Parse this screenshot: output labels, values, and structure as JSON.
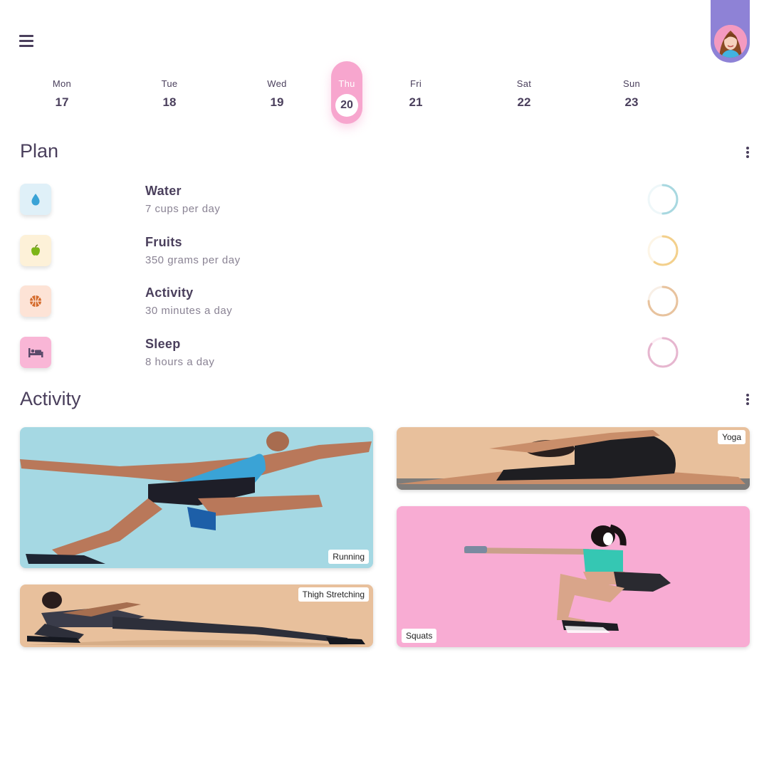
{
  "header": {
    "menu_icon": "hamburger-menu-icon",
    "avatar_icon": "user-avatar"
  },
  "week": {
    "days": [
      {
        "name": "Mon",
        "num": "17"
      },
      {
        "name": "Tue",
        "num": "18"
      },
      {
        "name": "Wed",
        "num": "19"
      },
      {
        "name": "Thu",
        "num": "20"
      },
      {
        "name": "Fri",
        "num": "21"
      },
      {
        "name": "Sat",
        "num": "22"
      },
      {
        "name": "Sun",
        "num": "23"
      }
    ],
    "selected": "Thu"
  },
  "plan": {
    "title": "Plan",
    "items": [
      {
        "name": "Water",
        "detail": "7 cups per day",
        "icon": "water-drop-icon",
        "color": "#3aa3d6",
        "bg": "#dff0f8",
        "ring_color": "#a8d8e0",
        "progress": 0.5
      },
      {
        "name": "Fruits",
        "detail": "350 grams per day",
        "icon": "apple-icon",
        "color": "#7cb518",
        "bg": "#fdf1d8",
        "ring_color": "#f3d08c",
        "progress": 0.6
      },
      {
        "name": "Activity",
        "detail": "30 minutes a day",
        "icon": "basketball-icon",
        "color": "#d46a2a",
        "bg": "#fde3d6",
        "ring_color": "#e8c39e",
        "progress": 0.75
      },
      {
        "name": "Sleep",
        "detail": "8 hours a day",
        "icon": "bed-icon",
        "color": "#5a4a6a",
        "bg": "#f9b6d6",
        "ring_color": "#e6b6cf",
        "progress": 0.85
      }
    ]
  },
  "activity": {
    "title": "Activity",
    "cards": [
      {
        "label": "Running",
        "bg": "#a5d8e3"
      },
      {
        "label": "Thigh Stretching",
        "bg": "#e8c09c"
      },
      {
        "label": "Yoga",
        "bg": "#e8c09c"
      },
      {
        "label": "Squats",
        "bg": "#f8acd3"
      }
    ]
  },
  "colors": {
    "accent_pink": "#f7a6ce",
    "avatar_purple": "#8e82d6",
    "text_primary": "#4a3f5c",
    "text_secondary": "#8a8394"
  }
}
